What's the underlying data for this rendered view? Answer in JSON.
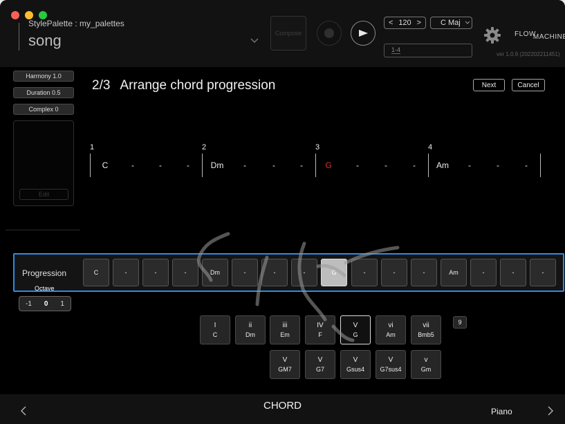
{
  "header": {
    "window_subtitle": "StylePalette : my_palettes",
    "window_title": "song",
    "compose_label": "Compose",
    "tempo_value": "120",
    "key_value": "C Maj",
    "range_value": "1-4",
    "brand_prefix": "FLOW",
    "brand_suffix": "MACHINES",
    "version": "ver 1.0.9 (202202211451)"
  },
  "sidebar": {
    "harmony": "Harmony 1.0",
    "duration": "Duration 0.5",
    "complex": "Complex 0",
    "edit": "Edit"
  },
  "step": {
    "number": "2/3",
    "title": "Arrange chord progression",
    "next": "Next",
    "cancel": "Cancel"
  },
  "bars": [
    {
      "num": "1",
      "beats": [
        "C",
        "-",
        "-",
        "-"
      ]
    },
    {
      "num": "2",
      "beats": [
        "Dm",
        "-",
        "-",
        "-"
      ]
    },
    {
      "num": "3",
      "beats": [
        "G",
        "-",
        "-",
        "-"
      ]
    },
    {
      "num": "4",
      "beats": [
        "Am",
        "-",
        "-",
        "-"
      ]
    }
  ],
  "progression": {
    "label": "Progression",
    "cells": [
      "C",
      "-",
      "-",
      "-",
      "Dm",
      "-",
      "-",
      "-",
      "G",
      "-",
      "-",
      "-",
      "Am",
      "-",
      "-",
      "-"
    ]
  },
  "octave": {
    "label": "Octave",
    "values": [
      "-1",
      "0",
      "1"
    ]
  },
  "chord_palette": {
    "row1": [
      {
        "deg": "I",
        "name": "C"
      },
      {
        "deg": "ii",
        "name": "Dm"
      },
      {
        "deg": "iii",
        "name": "Em"
      },
      {
        "deg": "IV",
        "name": "F"
      },
      {
        "deg": "V",
        "name": "G"
      },
      {
        "deg": "vi",
        "name": "Am"
      },
      {
        "deg": "vii",
        "name": "Bmb5"
      }
    ],
    "row2": [
      {
        "deg": "V",
        "name": "GM7"
      },
      {
        "deg": "V",
        "name": "G7"
      },
      {
        "deg": "V",
        "name": "Gsus4"
      },
      {
        "deg": "V",
        "name": "G7sus4"
      },
      {
        "deg": "v",
        "name": "Gm"
      }
    ],
    "extra": "9"
  },
  "footer": {
    "title": "CHORD",
    "instrument": "Piano"
  },
  "colors": {
    "accent_blue": "#2f8be6",
    "highlight_red": "#e0302a"
  }
}
